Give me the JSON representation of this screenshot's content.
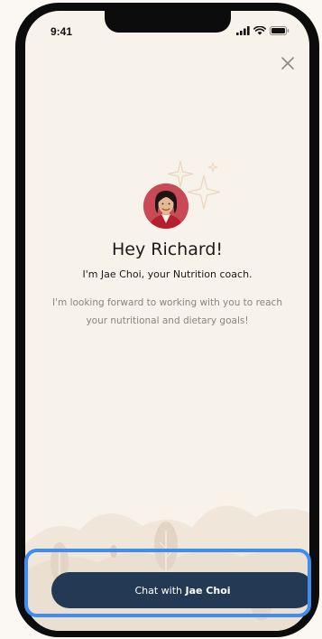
{
  "status_bar": {
    "time": "9:41",
    "icons": [
      "cellular-signal-icon",
      "wifi-icon",
      "battery-icon"
    ]
  },
  "header": {
    "close_icon": "close-icon"
  },
  "coach": {
    "greeting": "Hey Richard!",
    "intro": "I'm Jae Choi, your Nutrition coach.",
    "message": "I'm looking forward to working with you to reach your nutritional and dietary goals!"
  },
  "cta": {
    "prefix": "Chat with ",
    "name": "Jae Choi"
  },
  "colors": {
    "background": "#f7f2ea",
    "button": "#243a54",
    "highlight": "#3f8cf2",
    "avatar_bg": "#c94a55"
  }
}
